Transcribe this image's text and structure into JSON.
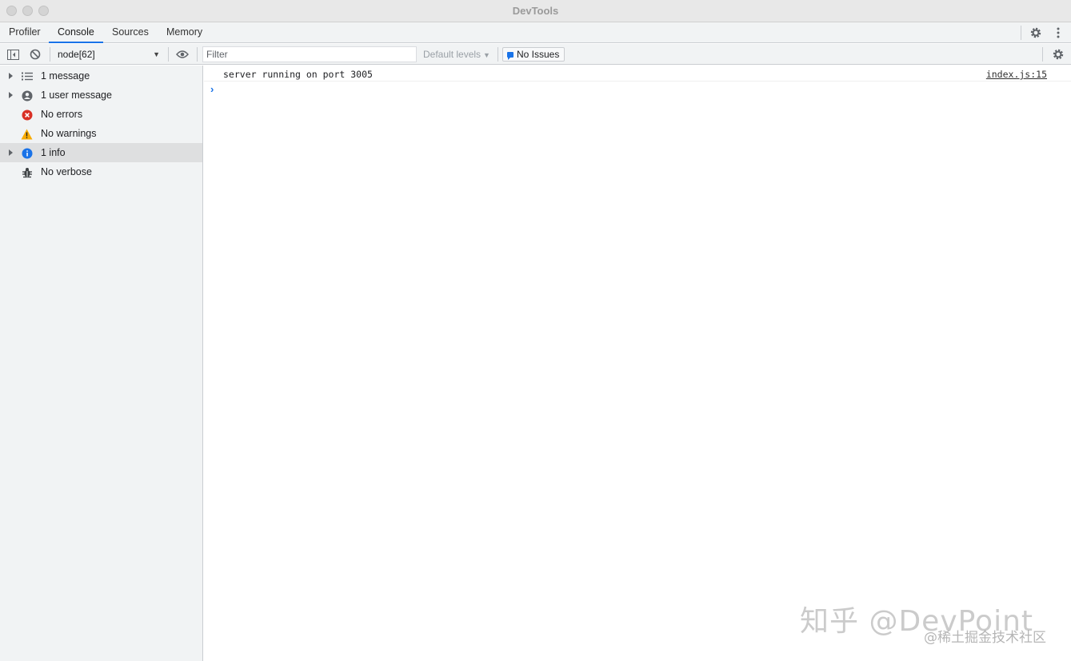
{
  "window": {
    "title": "DevTools"
  },
  "tabs": [
    {
      "label": "Profiler"
    },
    {
      "label": "Console"
    },
    {
      "label": "Sources"
    },
    {
      "label": "Memory"
    }
  ],
  "toolbar": {
    "context": "node[62]",
    "filter_placeholder": "Filter",
    "levels_label": "Default levels",
    "issues_label": "No Issues"
  },
  "sidebar": {
    "items": [
      {
        "label": "1 message",
        "icon": "list-icon",
        "expandable": true
      },
      {
        "label": "1 user message",
        "icon": "user-icon",
        "expandable": true
      },
      {
        "label": "No errors",
        "icon": "error-icon",
        "expandable": false
      },
      {
        "label": "No warnings",
        "icon": "warning-icon",
        "expandable": false
      },
      {
        "label": "1 info",
        "icon": "info-icon",
        "expandable": true,
        "selected": true
      },
      {
        "label": "No verbose",
        "icon": "bug-icon",
        "expandable": false
      }
    ]
  },
  "console": {
    "messages": [
      {
        "text": "server running on port 3005",
        "source": "index.js:15"
      }
    ],
    "prompt": "›"
  },
  "watermark": {
    "line1": "知乎 @DevPoint",
    "line2": "@稀土掘金技术社区"
  },
  "colors": {
    "accent": "#1a73e8",
    "error": "#d93025",
    "warning": "#f9ab00",
    "info": "#1a73e8"
  }
}
